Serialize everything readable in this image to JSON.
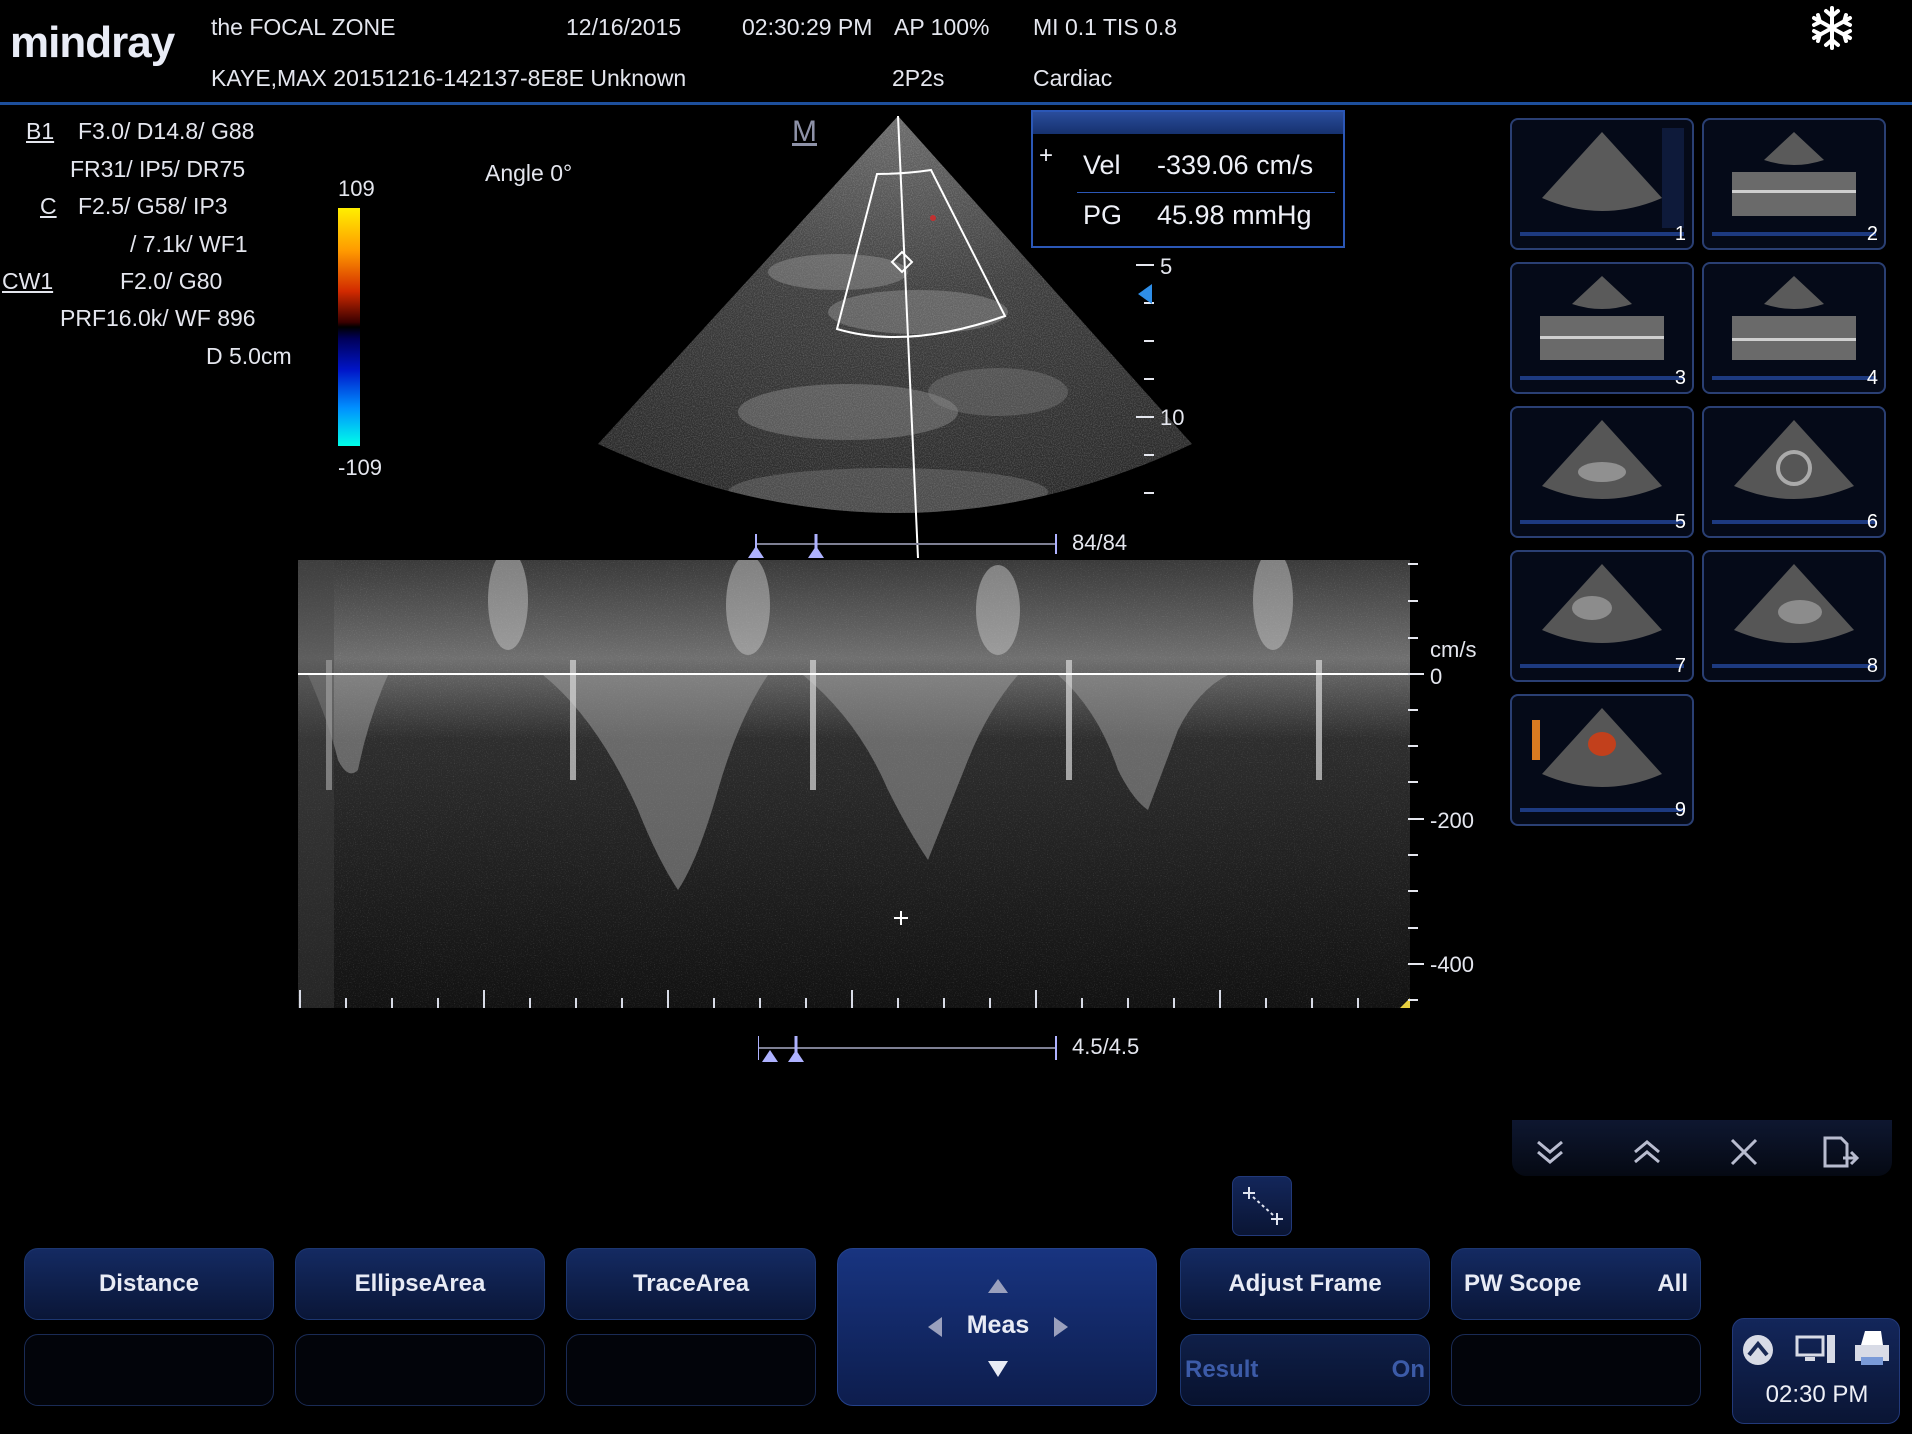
{
  "header": {
    "logo": "mindray",
    "institution": "the FOCAL ZONE",
    "date": "12/16/2015",
    "time": "02:30:29 PM",
    "ap": "AP  100%",
    "mi_tis": "MI 0.1 TIS 0.8",
    "patient": "KAYE,MAX 20151216-142137-8E8E Unknown",
    "probe": "2P2s",
    "exam": "Cardiac",
    "freeze_icon": "snowflake-icon"
  },
  "params": {
    "b1_label": "B1",
    "b1_line1": "F3.0/  D14.8/    G88",
    "b1_line2": "FR31/    IP5/  DR75",
    "c_label": "C",
    "c_line1": "F2.5/    G58/     IP3",
    "c_line2": "/    7.1k/   WF1",
    "cw_label": "CW1",
    "cw_line1": "F2.0/           G80",
    "cw_line2": "PRF16.0k/    WF 896",
    "cw_line3": "D 5.0cm",
    "angle": "Angle 0°"
  },
  "colorbar": {
    "top": "109",
    "bottom": "-109"
  },
  "sector": {
    "m_marker": "M",
    "depth_5": "5",
    "depth_10": "10",
    "frame_counter": "84/84"
  },
  "measurement": {
    "vel_label": "Vel",
    "vel_value": "-339.06 cm/s",
    "pg_label": "PG",
    "pg_value": "45.98 mmHg"
  },
  "doppler": {
    "unit": "cm/s",
    "tick_0": "0",
    "tick_200": "-200",
    "tick_400": "-400",
    "time_counter": "4.5/4.5"
  },
  "thumbnails": [
    "1",
    "2",
    "3",
    "4",
    "5",
    "6",
    "7",
    "8",
    "9"
  ],
  "toolbar": {
    "icons": [
      "double-chevron-down-icon",
      "double-chevron-up-icon",
      "close-icon",
      "export-icon"
    ]
  },
  "buttons": {
    "distance": "Distance",
    "ellipse_area": "EllipseArea",
    "trace_area": "TraceArea",
    "meas": "Meas",
    "adjust_frame": "Adjust Frame",
    "pw_scope": "PW Scope",
    "pw_scope_value": "All",
    "result": "Result",
    "result_value": "On"
  },
  "status": {
    "clock": "02:30 PM"
  }
}
